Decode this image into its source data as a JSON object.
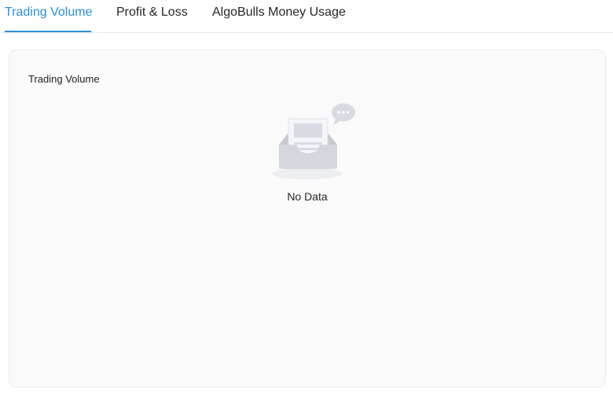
{
  "tabs": [
    {
      "label": "Trading Volume",
      "active": true
    },
    {
      "label": "Profit & Loss",
      "active": false
    },
    {
      "label": "AlgoBulls Money Usage",
      "active": false
    }
  ],
  "card": {
    "title": "Trading Volume",
    "empty_text": "No Data",
    "empty_icon": "empty-inbox-icon"
  },
  "colors": {
    "accent": "#2b8fd8",
    "card_background": "#fafafb",
    "illustration_gray": "#d9dbe3"
  }
}
